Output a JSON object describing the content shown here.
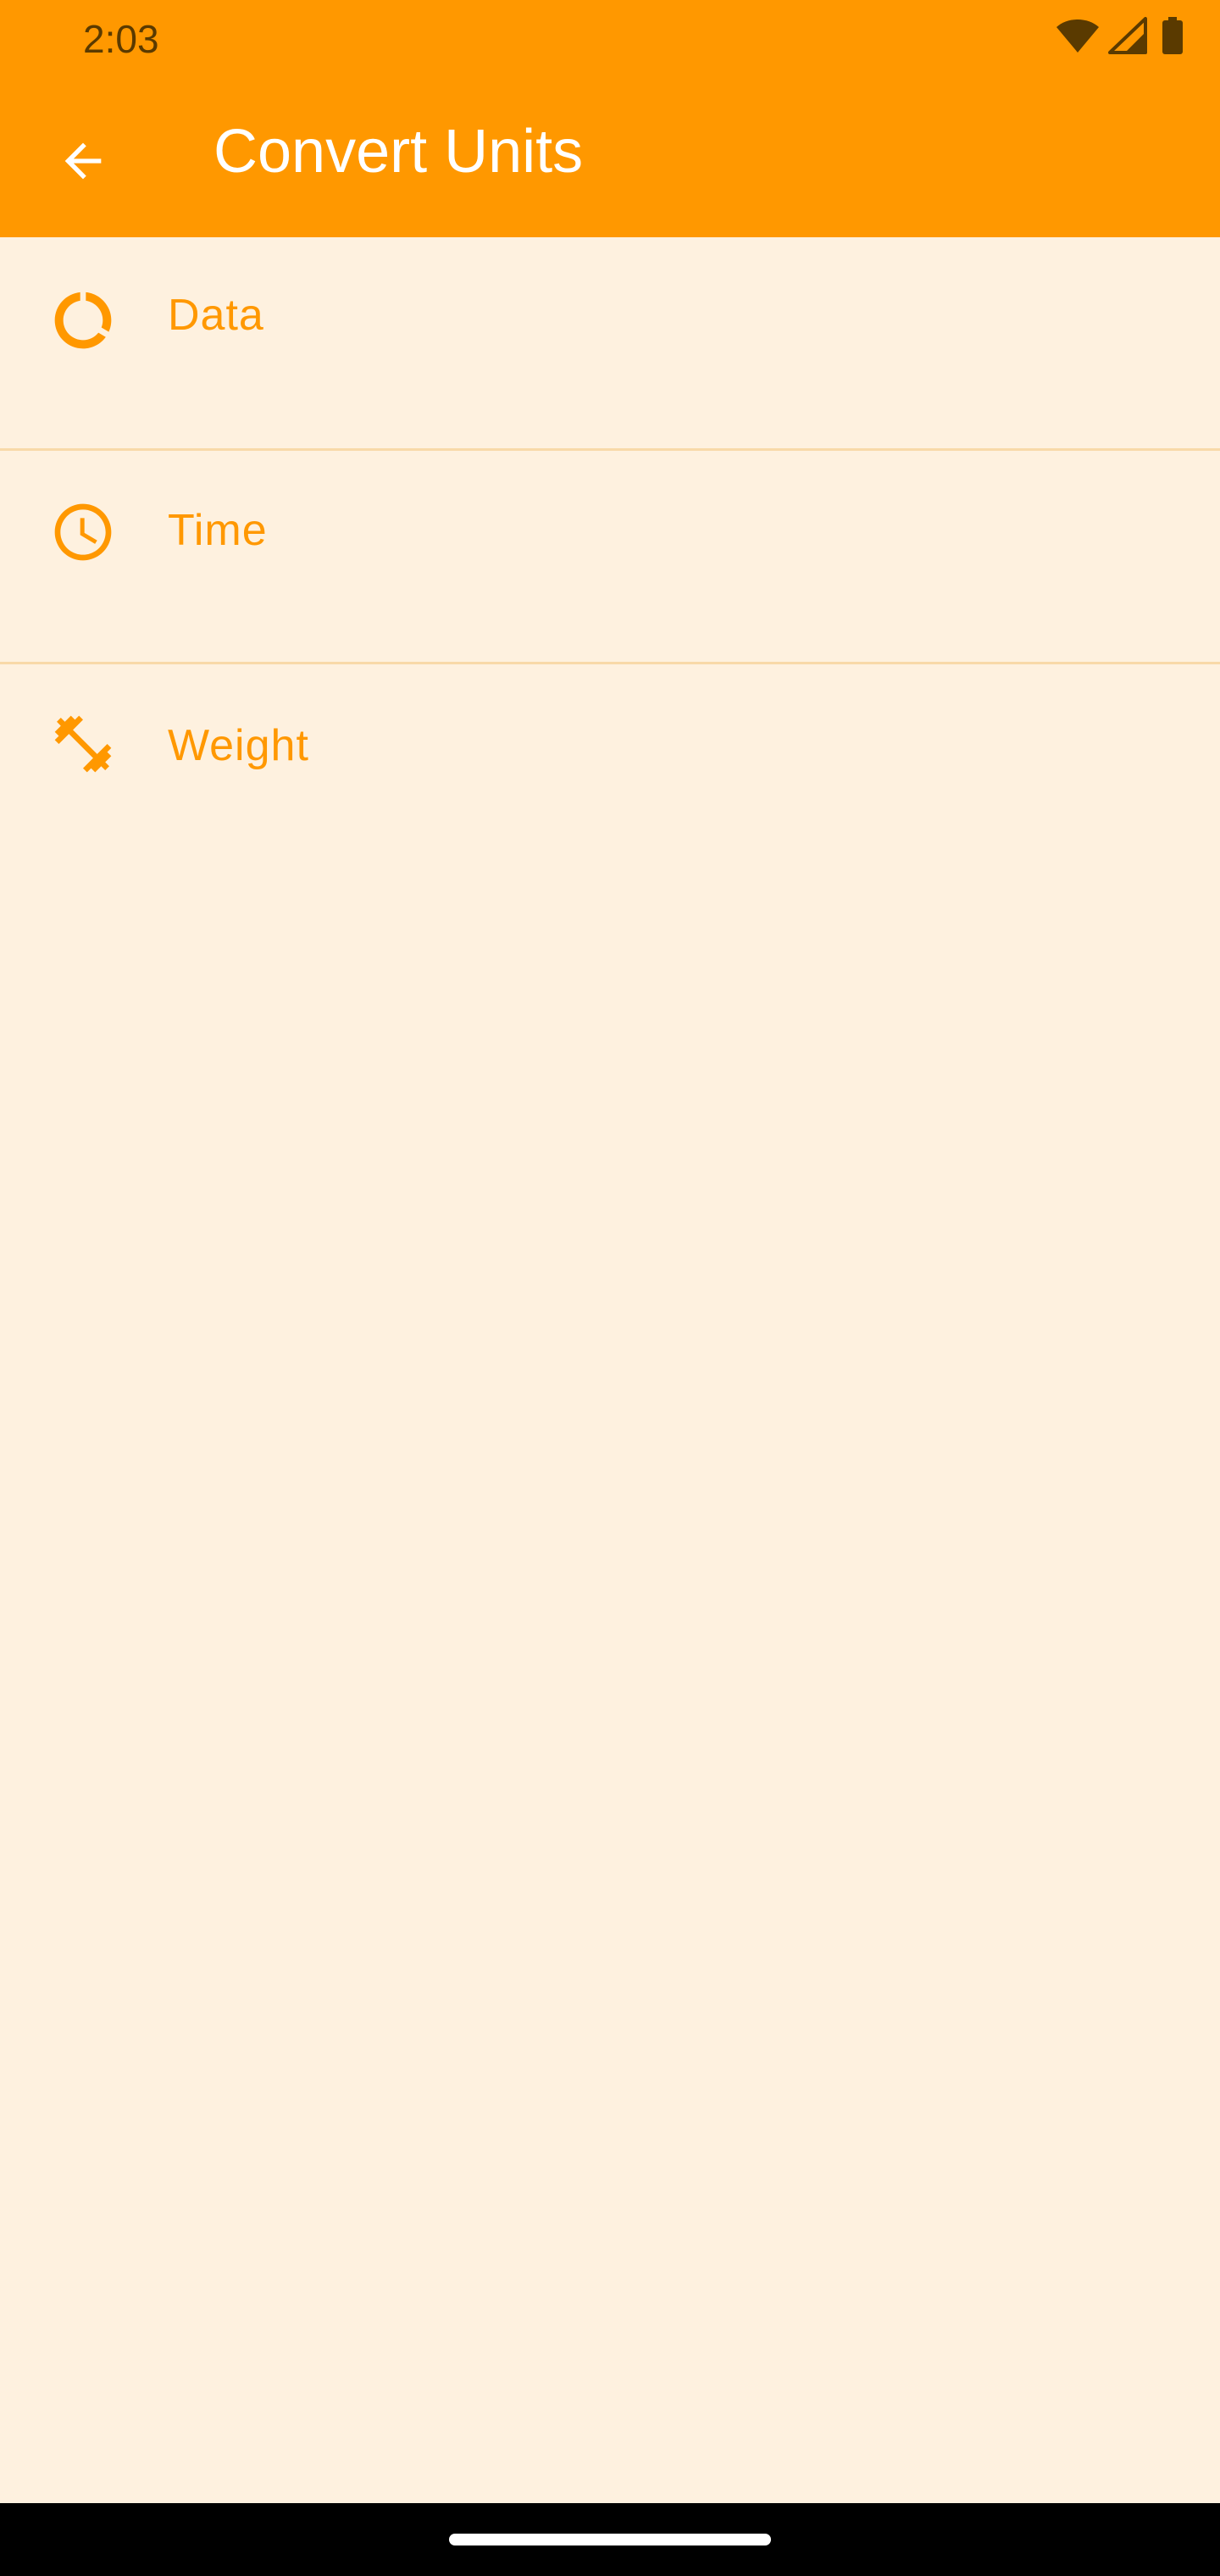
{
  "status_bar": {
    "time": "2:03",
    "icons": [
      "wifi-icon",
      "cellular-signal-icon",
      "battery-icon"
    ]
  },
  "toolbar": {
    "title": "Convert Units",
    "back_icon": "arrow-back-icon"
  },
  "list": {
    "items": [
      {
        "label": "Data",
        "icon": "data-usage-icon"
      },
      {
        "label": "Time",
        "icon": "clock-icon"
      },
      {
        "label": "Weight",
        "icon": "fitness-dumbbell-icon"
      }
    ]
  },
  "colors": {
    "primary": "#FF9800",
    "background": "#FEF1DF",
    "divider": "#F8D9A8",
    "on_primary": "#FFFFFF"
  }
}
